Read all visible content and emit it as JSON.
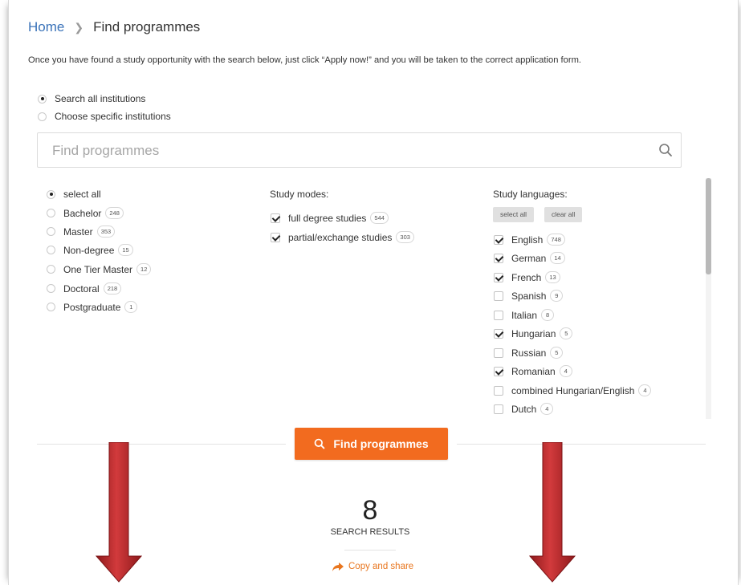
{
  "breadcrumb": {
    "home": "Home",
    "current": "Find programmes"
  },
  "intro": "Once you have found a study opportunity with the search below, just click “Apply now!” and you will be taken to the correct application form.",
  "institution_scope": {
    "all": "Search all institutions",
    "specific": "Choose specific institutions",
    "selected": "all"
  },
  "search": {
    "placeholder": "Find programmes",
    "value": ""
  },
  "levels": [
    {
      "label": "select all",
      "count": "",
      "selected": true
    },
    {
      "label": "Bachelor",
      "count": "248",
      "selected": false
    },
    {
      "label": "Master",
      "count": "353",
      "selected": false
    },
    {
      "label": "Non-degree",
      "count": "15",
      "selected": false
    },
    {
      "label": "One Tier Master",
      "count": "12",
      "selected": false
    },
    {
      "label": "Doctoral",
      "count": "218",
      "selected": false
    },
    {
      "label": "Postgraduate",
      "count": "1",
      "selected": false
    }
  ],
  "study_modes": {
    "heading": "Study modes:",
    "items": [
      {
        "label": "full degree studies",
        "count": "544",
        "checked": true
      },
      {
        "label": "partial/exchange studies",
        "count": "303",
        "checked": true
      }
    ]
  },
  "study_languages": {
    "heading": "Study languages:",
    "select_all": "select all",
    "clear_all": "clear all",
    "items": [
      {
        "label": "English",
        "count": "748",
        "checked": true
      },
      {
        "label": "German",
        "count": "14",
        "checked": true
      },
      {
        "label": "French",
        "count": "13",
        "checked": true
      },
      {
        "label": "Spanish",
        "count": "9",
        "checked": false
      },
      {
        "label": "Italian",
        "count": "8",
        "checked": false
      },
      {
        "label": "Hungarian",
        "count": "5",
        "checked": true
      },
      {
        "label": "Russian",
        "count": "5",
        "checked": false
      },
      {
        "label": "Romanian",
        "count": "4",
        "checked": true
      },
      {
        "label": "combined Hungarian/English",
        "count": "4",
        "checked": false
      },
      {
        "label": "Dutch",
        "count": "4",
        "checked": false
      }
    ]
  },
  "find_button": "Find programmes",
  "results": {
    "count": "8",
    "label": "SEARCH RESULTS",
    "copy_share": "Copy and share"
  },
  "colors": {
    "accent": "#f26b1f",
    "link": "#3b73b9",
    "arrow": "#c0282b"
  }
}
